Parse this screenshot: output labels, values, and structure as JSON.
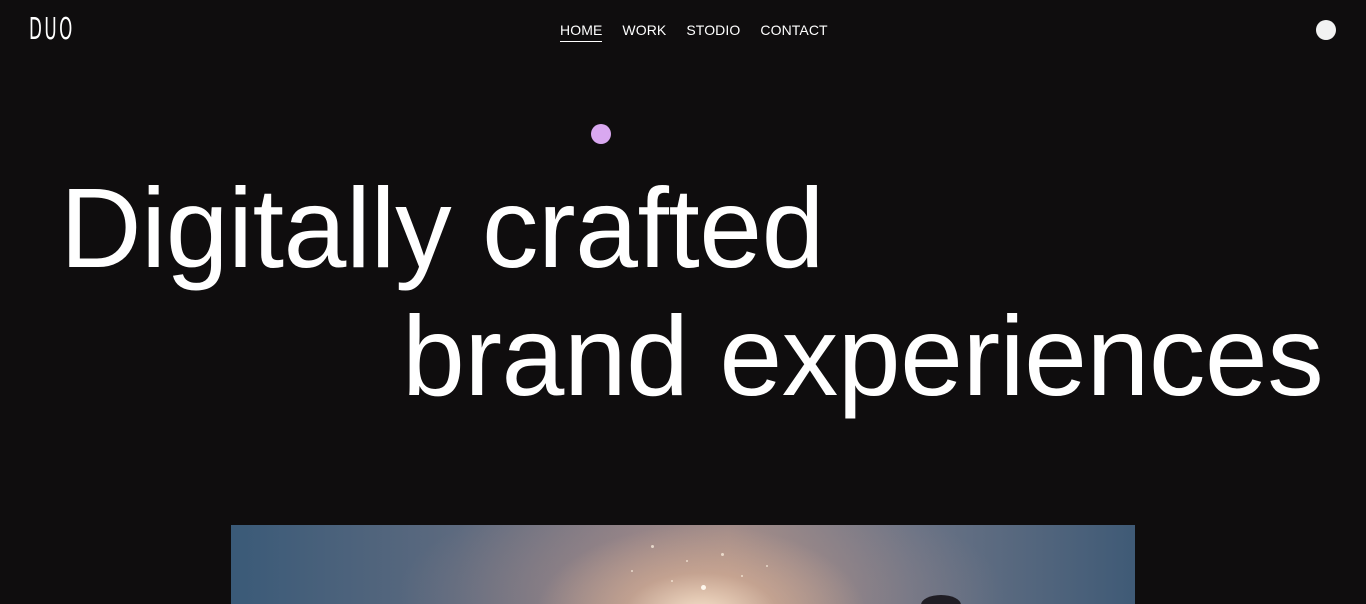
{
  "header": {
    "logo_text": "DUO",
    "nav": [
      {
        "label": "HOME",
        "active": true
      },
      {
        "label": "WORK",
        "active": false
      },
      {
        "label": "STODIO",
        "active": false
      },
      {
        "label": "CONTACT",
        "active": false
      }
    ],
    "toggle_icon": "circle-toggle-icon"
  },
  "hero": {
    "line1": "Digitally crafted",
    "line2": "brand experiences",
    "accent_dot_color": "#d9a8f0",
    "image_description_icon": "hero-image"
  },
  "colors": {
    "background": "#0f0d0e",
    "text": "#ffffff",
    "accent": "#d9a8f0",
    "toggle": "#f2f2f2"
  }
}
